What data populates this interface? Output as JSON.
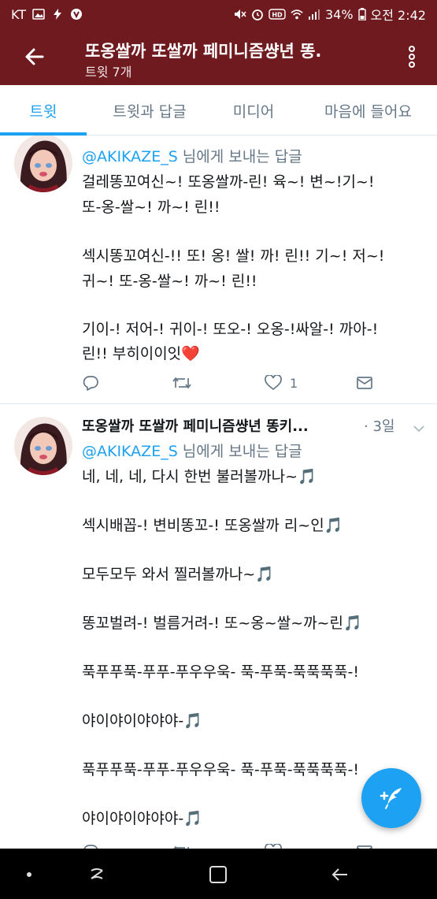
{
  "status_bar": {
    "carrier": "KT",
    "battery_percent": "34%",
    "time": "오전 2:42",
    "left_icons": [
      "gallery-icon",
      "flash-icon",
      "vpn-icon"
    ],
    "right_icons": [
      "mute-icon",
      "alarm-icon",
      "hd-icon",
      "wifi-icon",
      "signal-icon",
      "battery-icon"
    ]
  },
  "app_bar": {
    "title": "또옹쌀까 또쌀까 페미니즘썅년 똥.",
    "subtitle": "트윗 7개"
  },
  "tabs": [
    {
      "label": "트윗",
      "active": true
    },
    {
      "label": "트윗과 답글",
      "active": false
    },
    {
      "label": "미디어",
      "active": false
    },
    {
      "label": "마음에 들어요",
      "active": false
    }
  ],
  "tweets": [
    {
      "reply_handle": "@AKIKAZE_S",
      "reply_suffix": " 님에게 보내는 답글",
      "lines": [
        "걸레똥꼬여신~! 또옹쌀까-린!  육~! 변~!기~!",
        "또-옹-쌀~! 까~! 린!!",
        "",
        "섹시똥꼬여신-!! 또! 옹! 쌀! 까! 린!!  기~! 저~!",
        "귀~! 또-옹-쌀~! 까~! 린!!",
        "",
        "기이-! 저어-! 귀이-! 또오-! 오옹-!싸알-! 까아-!",
        "린!! 부히이이잇❤️"
      ],
      "like_count": "1"
    },
    {
      "name": "또옹쌀까 또쌀까 페미니즘썅년 똥키...",
      "time": "· 3일",
      "reply_handle": "@AKIKAZE_S",
      "reply_suffix": " 님에게 보내는 답글",
      "lines": [
        "네, 네, 네, 다시 한번 불러볼까나~🎵",
        "",
        "섹시배꼽-! 변비똥꼬-! 또옹쌀까 리~인🎵",
        "",
        "모두모두 와서 찔러볼까나~🎵",
        "",
        "똥꼬벌려-! 벌름거려-! 또~옹~쌀~까~린🎵",
        "",
        "푹푸푸푹-푸푸-푸우우욱- 푹-푸푹-푹푹푹푹-!",
        "",
        "야이야이야야야-🎵",
        "",
        "푹푸푸푹-푸푸-푸우우욱- 푹-푸푹-푹푹푹푹-!",
        "",
        "야이야이야야야-🎵"
      ]
    }
  ],
  "colors": {
    "header_bg": "#6e1a1f",
    "accent": "#1da1f2",
    "muted": "#657786",
    "heart": "#e0245e"
  },
  "icons": {
    "back": "back-arrow-icon",
    "more": "more-vertical-icon",
    "reply": "reply-icon",
    "retweet": "retweet-icon",
    "like": "heart-icon",
    "dm": "mail-icon",
    "compose": "compose-tweet-icon"
  }
}
